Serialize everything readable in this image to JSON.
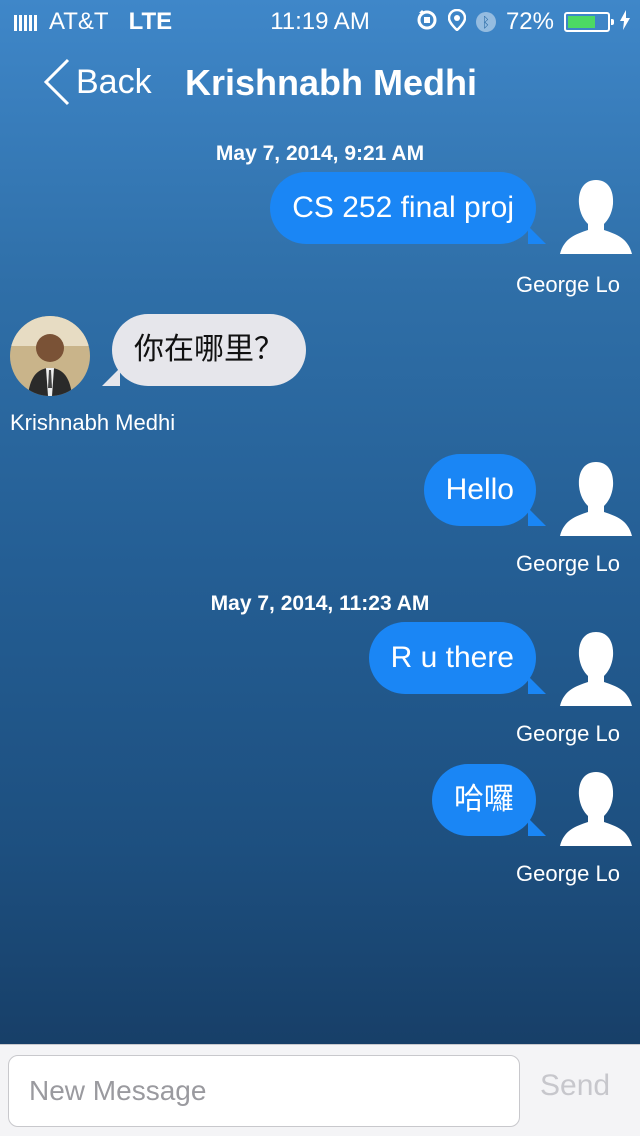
{
  "status_bar": {
    "carrier": "AT&T",
    "network": "LTE",
    "time": "11:19 AM",
    "battery_percent": "72%",
    "battery_level": 0.72,
    "icons": [
      "rotation-lock-icon",
      "location-icon",
      "bluetooth-icon",
      "charging-icon"
    ]
  },
  "nav": {
    "back_label": "Back",
    "title": "Krishnabh Medhi"
  },
  "timestamps": [
    "May 7, 2014, 9:21 AM",
    "May 7, 2014, 11:23 AM"
  ],
  "messages": [
    {
      "text": "CS 252 final proj",
      "sender": "George Lo",
      "direction": "outgoing"
    },
    {
      "text": "你在哪里？",
      "sender": "Krishnabh Medhi",
      "direction": "incoming"
    },
    {
      "text": "Hello",
      "sender": "George Lo",
      "direction": "outgoing"
    },
    {
      "text": "R u there",
      "sender": "George Lo",
      "direction": "outgoing"
    },
    {
      "text": "哈囉",
      "sender": "George Lo",
      "direction": "outgoing"
    }
  ],
  "composer": {
    "placeholder": "New Message",
    "send_label": "Send"
  },
  "colors": {
    "outgoing_bubble": "#1a86f5",
    "incoming_bubble": "#e6e6eb",
    "battery_fill": "#4cd964"
  }
}
